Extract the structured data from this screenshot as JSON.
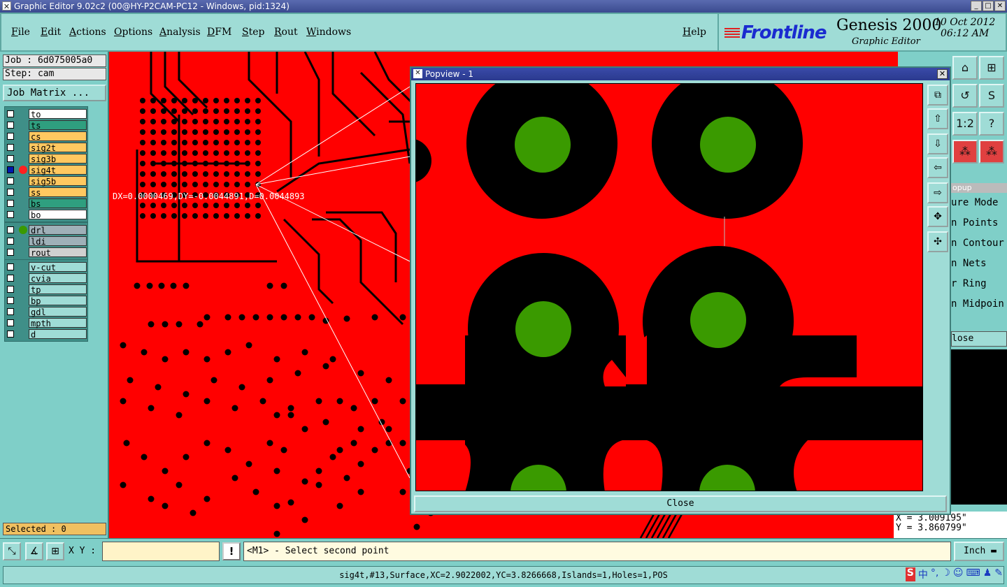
{
  "window": {
    "title": "Graphic Editor 9.02c2 (00@HY-P2CAM-PC12 - Windows, pid:1324)"
  },
  "menu": [
    "File",
    "Edit",
    "Actions",
    "Options",
    "Analysis",
    "DFM",
    "Step",
    "Rout",
    "Windows"
  ],
  "help_label": "Help",
  "logo": {
    "brand": "Frontline",
    "product": "Genesis 2000",
    "subtitle": "Graphic Editor",
    "date": "10 Oct 2012",
    "time": "06:12 AM"
  },
  "job": {
    "job_label": "Job : 6d075005a0",
    "step_label": "Step: cam",
    "matrix_button": "Job Matrix ..."
  },
  "layers_group1": [
    {
      "name": "to",
      "color": "#ffffff"
    },
    {
      "name": "ts",
      "color": "#2f9f7f"
    },
    {
      "name": "cs",
      "color": "#ffc860"
    },
    {
      "name": "sig2t",
      "color": "#ffc860"
    },
    {
      "name": "sig3b",
      "color": "#ffc860"
    },
    {
      "name": "sig4t",
      "color": "#ffc860",
      "active": true
    },
    {
      "name": "sig5b",
      "color": "#ffc860"
    },
    {
      "name": "ss",
      "color": "#ffc860"
    },
    {
      "name": "bs",
      "color": "#2f9f7f"
    },
    {
      "name": "bo",
      "color": "#ffffff"
    }
  ],
  "layers_group2": [
    {
      "name": "drl",
      "color": "#9fb0b8"
    },
    {
      "name": "ldi",
      "color": "#9fb0b8"
    },
    {
      "name": "rout",
      "color": "#d0d0d0"
    }
  ],
  "layers_group3": [
    {
      "name": "v-cut",
      "color": "#9fdcd6"
    },
    {
      "name": "cvia",
      "color": "#9fdcd6"
    },
    {
      "name": "tp",
      "color": "#9fdcd6"
    },
    {
      "name": "bp",
      "color": "#9fdcd6"
    },
    {
      "name": "gdl",
      "color": "#9fdcd6"
    },
    {
      "name": "mpth",
      "color": "#9fdcd6"
    },
    {
      "name": "d",
      "color": "#9fdcd6"
    }
  ],
  "selected_label": "Selected : 0",
  "measurement_text": "DX=0.0000469,DY=-0.0044891,D=0.0044893",
  "popview": {
    "title": "Popview - 1",
    "close_label": "Close"
  },
  "measure_menu": {
    "title": "opup",
    "items": [
      "ure Mode",
      "n Points",
      "n Contour",
      "n Nets",
      "r Ring",
      "n Midpoin"
    ],
    "close_label": "lose"
  },
  "coords": {
    "x": "X = 3.009195\"",
    "y": "Y = 3.860799\""
  },
  "bottom": {
    "xy_label": "X Y :",
    "xy_value": "",
    "warn": "!",
    "prompt": "<M1> - Select second point",
    "units": "Inch"
  },
  "status": "sig4t,#13,Surface,XC=2.9022002,YC=3.8266668,Islands=1,Holes=1,POS",
  "tray": [
    "S",
    "中",
    "°,",
    "☽",
    "☺",
    "⌨",
    "♟",
    "✎"
  ],
  "colors": {
    "copper": "#ff0000",
    "pad": "#000000",
    "drill": "#3a9a00",
    "panel": "#7fcfc8"
  }
}
